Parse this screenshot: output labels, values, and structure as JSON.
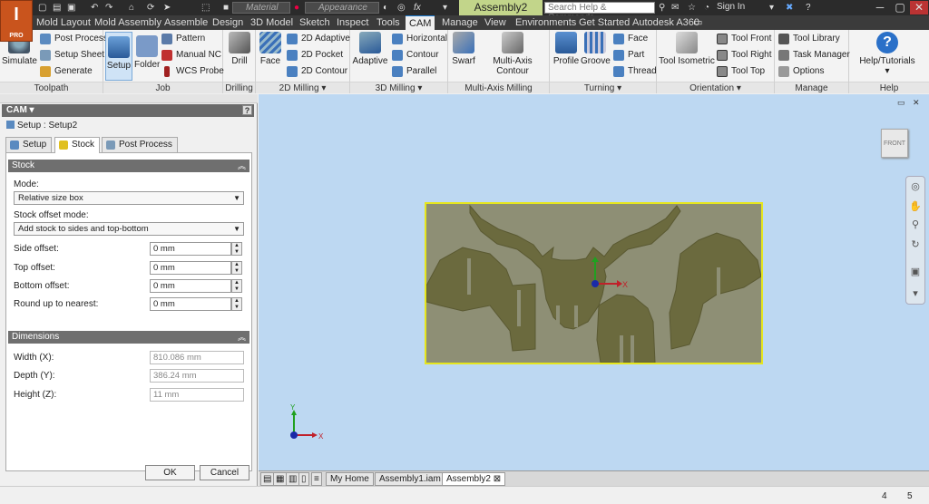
{
  "app": {
    "logo_text": "I",
    "logo_badge": "PRO",
    "doc_title": "Assembly2"
  },
  "quick_access": {
    "material": "Material",
    "appearance": "Appearance",
    "fx": "fx",
    "search_placeholder": "Search Help & Commands...",
    "sign_in": "Sign In"
  },
  "menu_tabs": [
    "Mold Layout",
    "Mold Assembly",
    "Assemble",
    "Design",
    "3D Model",
    "Sketch",
    "Inspect",
    "Tools",
    "CAM",
    "Manage",
    "View",
    "Environments",
    "Get Started",
    "Autodesk A360"
  ],
  "active_menu": "CAM",
  "ribbon": {
    "toolpath": {
      "title": "Toolpath",
      "simulate": "Simulate",
      "post_process": "Post Process",
      "setup_sheet": "Setup Sheet",
      "generate": "Generate"
    },
    "job": {
      "title": "Job",
      "setup": "Setup",
      "folder": "Folder",
      "pattern": "Pattern",
      "manual_nc": "Manual NC",
      "wcs_probe": "WCS Probe"
    },
    "drilling": {
      "title": "Drilling",
      "drill": "Drill"
    },
    "milling2d": {
      "title": "2D Milling",
      "face": "Face",
      "adaptive2d": "2D Adaptive",
      "pocket2d": "2D Pocket",
      "contour2d": "2D Contour"
    },
    "milling3d": {
      "title": "3D Milling",
      "adaptive": "Adaptive",
      "horizontal": "Horizontal",
      "contour": "Contour",
      "parallel": "Parallel"
    },
    "multiaxis": {
      "title": "Multi-Axis Milling",
      "swarf": "Swarf",
      "multi_axis_contour": "Multi-Axis Contour"
    },
    "turning": {
      "title": "Turning",
      "profile": "Profile",
      "groove": "Groove",
      "face": "Face",
      "part": "Part",
      "thread": "Thread"
    },
    "orientation": {
      "title": "Orientation",
      "tool_isometric": "Tool Isometric",
      "tool_front": "Tool Front",
      "tool_right": "Tool Right",
      "tool_top": "Tool Top"
    },
    "manage": {
      "title": "Manage",
      "tool_library": "Tool Library",
      "task_manager": "Task Manager",
      "options": "Options"
    },
    "help": {
      "title": "Help",
      "help_tutorials": "Help/Tutorials"
    }
  },
  "cam_panel": {
    "header": "CAM",
    "setup_label": "Setup : Setup2",
    "tabs": [
      "Setup",
      "Stock",
      "Post Process"
    ],
    "active_tab": "Stock",
    "stock_section": {
      "title": "Stock",
      "mode_label": "Mode:",
      "mode_value": "Relative size box",
      "offset_mode_label": "Stock offset mode:",
      "offset_mode_value": "Add stock to sides and top-bottom",
      "fields": [
        {
          "label": "Side offset:",
          "value": "0 mm"
        },
        {
          "label": "Top offset:",
          "value": "0 mm"
        },
        {
          "label": "Bottom offset:",
          "value": "0 mm"
        },
        {
          "label": "Round up to nearest:",
          "value": "0 mm"
        }
      ]
    },
    "dimensions_section": {
      "title": "Dimensions",
      "fields": [
        {
          "label": "Width (X):",
          "value": "810.086 mm"
        },
        {
          "label": "Depth (Y):",
          "value": "386.24 mm"
        },
        {
          "label": "Height (Z):",
          "value": "11 mm"
        }
      ]
    },
    "ok": "OK",
    "cancel": "Cancel"
  },
  "viewport": {
    "viewcube_label": "FRONT",
    "axis_x": "X",
    "axis_y": "Y"
  },
  "doc_tabs": [
    "My Home",
    "Assembly1.iam",
    "Assembly2"
  ],
  "active_doc_tab": "Assembly2",
  "status": {
    "left": "4",
    "right": "5"
  }
}
